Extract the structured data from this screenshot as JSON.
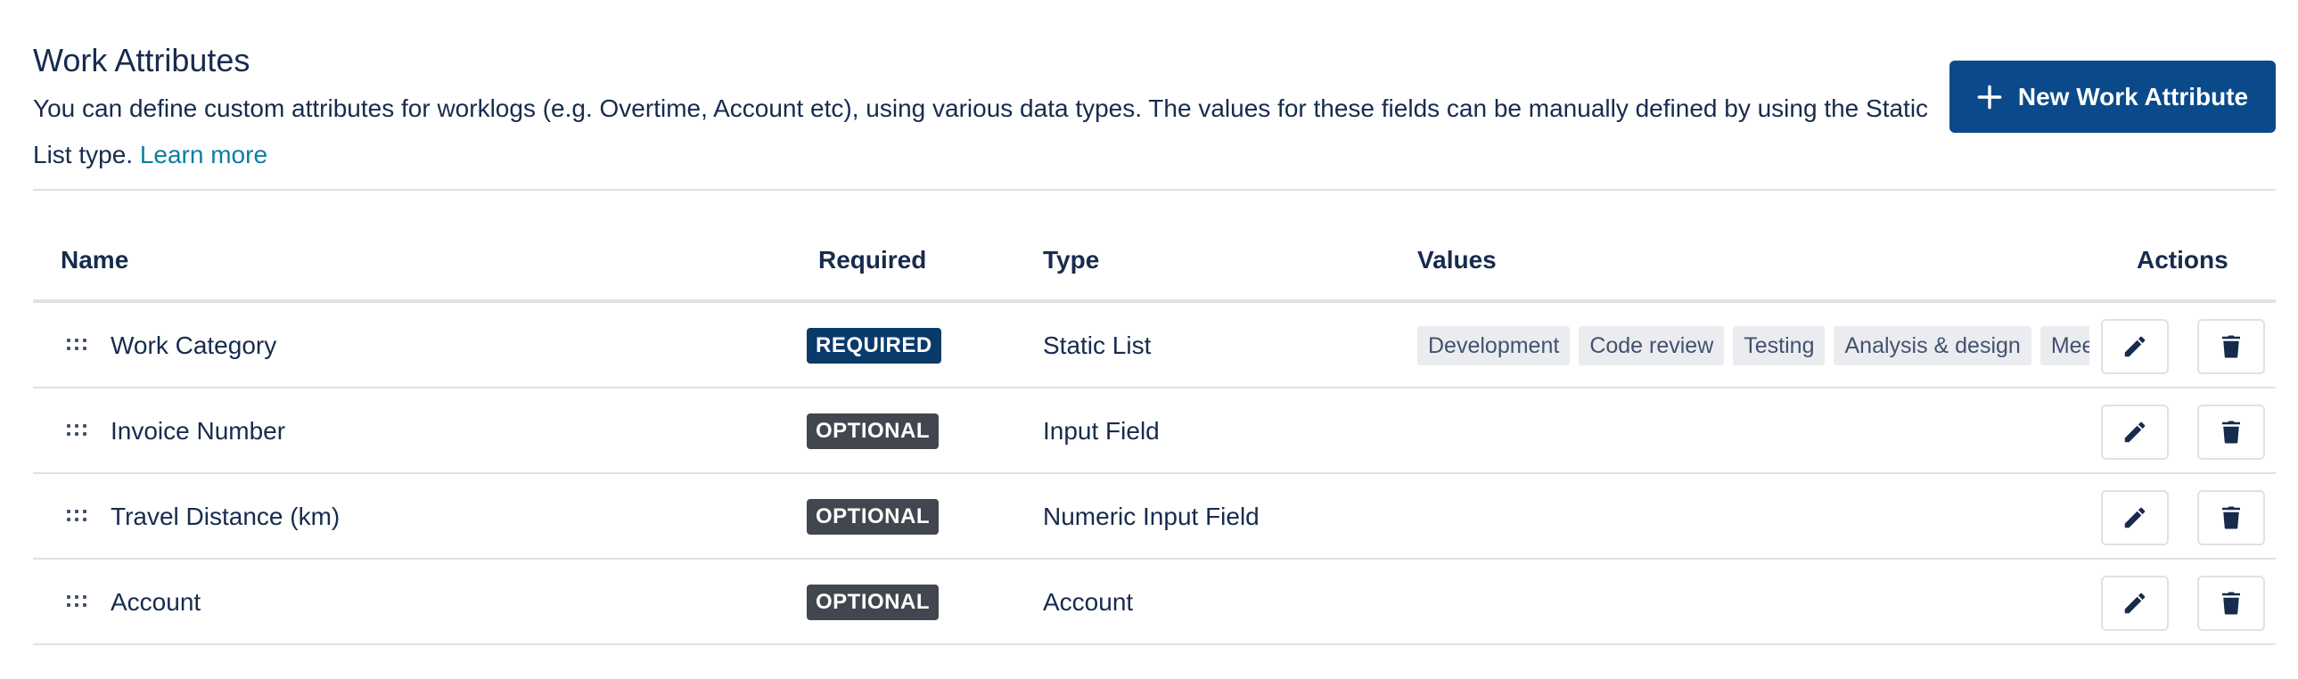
{
  "header": {
    "title": "Work Attributes",
    "description": "You can define custom attributes for worklogs (e.g. Overtime, Account etc), using various data types. The values for these fields can be manually defined by using the Static List type.",
    "learn_more": "Learn more",
    "new_button_label": "New Work Attribute"
  },
  "table": {
    "columns": {
      "name": "Name",
      "required": "Required",
      "type": "Type",
      "values": "Values",
      "actions": "Actions"
    },
    "rows": [
      {
        "name": "Work Category",
        "required": "REQUIRED",
        "type": "Static List",
        "values": [
          "Development",
          "Code review",
          "Testing",
          "Analysis & design",
          "Meetings"
        ]
      },
      {
        "name": "Invoice Number",
        "required": "OPTIONAL",
        "type": "Input Field",
        "values": []
      },
      {
        "name": "Travel Distance (km)",
        "required": "OPTIONAL",
        "type": "Numeric Input Field",
        "values": []
      },
      {
        "name": "Account",
        "required": "OPTIONAL",
        "type": "Account",
        "values": []
      }
    ]
  },
  "colors": {
    "primary": "#0a4a8a",
    "required_badge": "#0a3a6a",
    "optional_badge": "#42474f",
    "link": "#0b7ea3",
    "chip_bg": "#ebecf0"
  },
  "icons": {
    "plus": "plus-icon",
    "drag": "drag-handle-icon",
    "edit": "pencil-icon",
    "delete": "trash-icon"
  }
}
